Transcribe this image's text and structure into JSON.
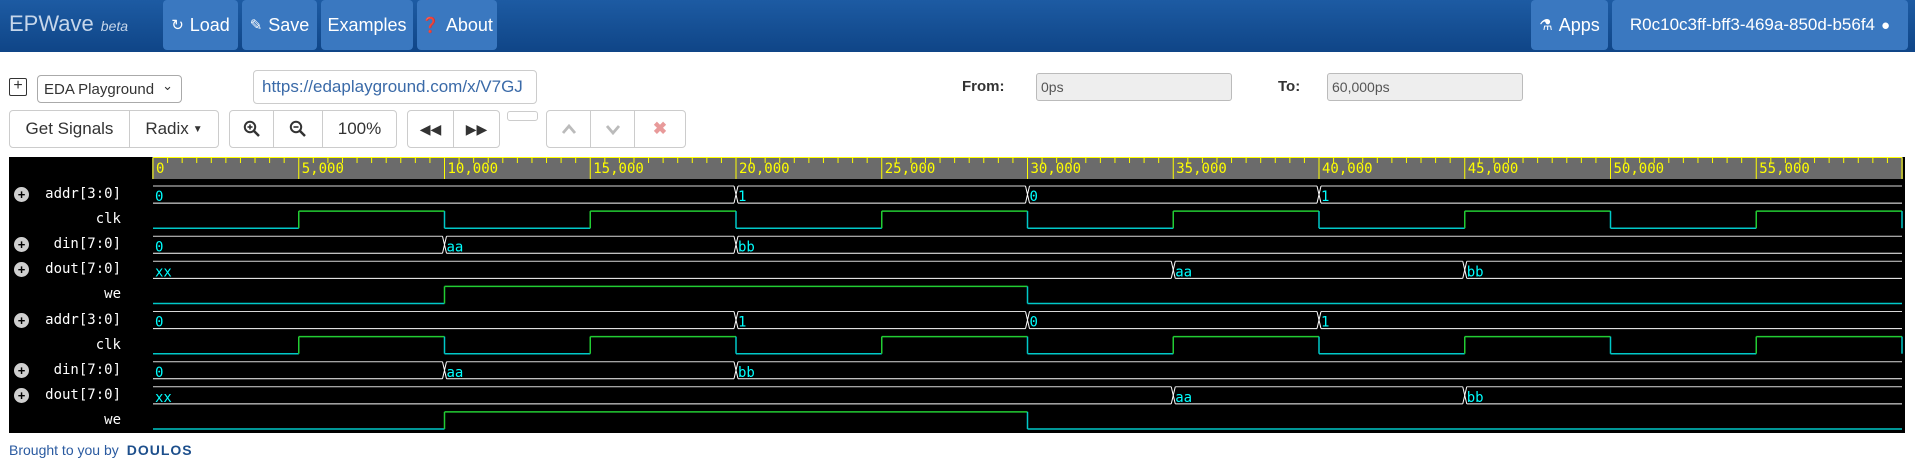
{
  "nav": {
    "brand": "EPWave",
    "beta": "beta",
    "load": "Load",
    "save": "Save",
    "examples": "Examples",
    "about": "About",
    "apps": "Apps",
    "user": "R0c10c3ff-bff3-469a-850d-b56f4",
    "icons": {
      "load": "refresh-icon",
      "save": "pencil-icon",
      "about": "question-circle-icon",
      "apps": "flask-icon",
      "user": "user-icon"
    }
  },
  "controls": {
    "source_select": "EDA Playground",
    "url": "https://edaplayground.com/x/V7GJ",
    "from_label": "From:",
    "from_value": "0ps",
    "to_label": "To:",
    "to_value": "60,000ps",
    "get_signals": "Get Signals",
    "radix": "Radix",
    "zoom_level": "100%"
  },
  "colors": {
    "navbar": "#1a5499",
    "nav_button": "#3a78c0",
    "wave_bg": "#000000",
    "ruler": "#6b6b6b",
    "ruler_text": "#ffff00",
    "value": "#00ffff",
    "wave_low": "#00c8c8",
    "wave_high": "#22cc33",
    "bus": "#ffffff"
  },
  "timeline": {
    "unit": "ps",
    "start": 0,
    "end": 60000,
    "labels": [
      "0",
      "5,000",
      "10,000",
      "15,000",
      "20,000",
      "25,000",
      "30,000",
      "35,000",
      "40,000",
      "45,000",
      "50,000",
      "55,000"
    ]
  },
  "signals": [
    {
      "name": "addr[3:0]",
      "bus": true,
      "segments": [
        {
          "t": 0,
          "v": "0"
        },
        {
          "t": 20000,
          "v": "1"
        },
        {
          "t": 30000,
          "v": "0"
        },
        {
          "t": 40000,
          "v": "1"
        }
      ]
    },
    {
      "name": "clk",
      "bus": false,
      "edges": [
        {
          "t": 0,
          "v": 0
        },
        {
          "t": 5000,
          "v": 1
        },
        {
          "t": 10000,
          "v": 0
        },
        {
          "t": 15000,
          "v": 1
        },
        {
          "t": 20000,
          "v": 0
        },
        {
          "t": 25000,
          "v": 1
        },
        {
          "t": 30000,
          "v": 0
        },
        {
          "t": 35000,
          "v": 1
        },
        {
          "t": 40000,
          "v": 0
        },
        {
          "t": 45000,
          "v": 1
        },
        {
          "t": 50000,
          "v": 0
        },
        {
          "t": 55000,
          "v": 1
        },
        {
          "t": 60000,
          "v": 0
        }
      ]
    },
    {
      "name": "din[7:0]",
      "bus": true,
      "segments": [
        {
          "t": 0,
          "v": "0"
        },
        {
          "t": 10000,
          "v": "aa"
        },
        {
          "t": 20000,
          "v": "bb"
        }
      ]
    },
    {
      "name": "dout[7:0]",
      "bus": true,
      "segments": [
        {
          "t": 0,
          "v": "xx"
        },
        {
          "t": 35000,
          "v": "aa"
        },
        {
          "t": 45000,
          "v": "bb"
        }
      ]
    },
    {
      "name": "we",
      "bus": false,
      "edges": [
        {
          "t": 0,
          "v": 0
        },
        {
          "t": 10000,
          "v": 1
        },
        {
          "t": 30000,
          "v": 0
        }
      ]
    },
    {
      "name": "addr[3:0]",
      "bus": true,
      "segments": [
        {
          "t": 0,
          "v": "0"
        },
        {
          "t": 20000,
          "v": "1"
        },
        {
          "t": 30000,
          "v": "0"
        },
        {
          "t": 40000,
          "v": "1"
        }
      ]
    },
    {
      "name": "clk",
      "bus": false,
      "edges": [
        {
          "t": 0,
          "v": 0
        },
        {
          "t": 5000,
          "v": 1
        },
        {
          "t": 10000,
          "v": 0
        },
        {
          "t": 15000,
          "v": 1
        },
        {
          "t": 20000,
          "v": 0
        },
        {
          "t": 25000,
          "v": 1
        },
        {
          "t": 30000,
          "v": 0
        },
        {
          "t": 35000,
          "v": 1
        },
        {
          "t": 40000,
          "v": 0
        },
        {
          "t": 45000,
          "v": 1
        },
        {
          "t": 50000,
          "v": 0
        },
        {
          "t": 55000,
          "v": 1
        },
        {
          "t": 60000,
          "v": 0
        }
      ]
    },
    {
      "name": "din[7:0]",
      "bus": true,
      "segments": [
        {
          "t": 0,
          "v": "0"
        },
        {
          "t": 10000,
          "v": "aa"
        },
        {
          "t": 20000,
          "v": "bb"
        }
      ]
    },
    {
      "name": "dout[7:0]",
      "bus": true,
      "segments": [
        {
          "t": 0,
          "v": "xx"
        },
        {
          "t": 35000,
          "v": "aa"
        },
        {
          "t": 45000,
          "v": "bb"
        }
      ]
    },
    {
      "name": "we",
      "bus": false,
      "edges": [
        {
          "t": 0,
          "v": 0
        },
        {
          "t": 10000,
          "v": 1
        },
        {
          "t": 30000,
          "v": 0
        }
      ]
    }
  ],
  "footer": {
    "text": "Brought to you by",
    "logo": "DOULOS"
  }
}
